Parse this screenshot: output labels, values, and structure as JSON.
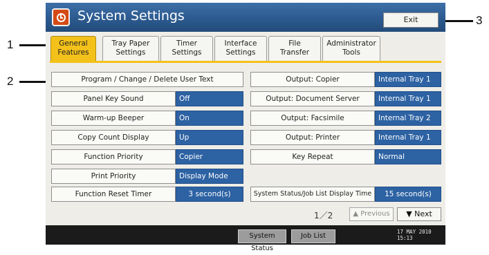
{
  "callouts": {
    "one": "1",
    "two": "2",
    "three": "3"
  },
  "header": {
    "title": "System Settings",
    "exit_label": "Exit"
  },
  "tabs": [
    {
      "line1": "General",
      "line2": "Features"
    },
    {
      "line1": "Tray Paper",
      "line2": "Settings"
    },
    {
      "line1": "Timer",
      "line2": "Settings"
    },
    {
      "line1": "Interface",
      "line2": "Settings"
    },
    {
      "line1": "File",
      "line2": "Transfer"
    },
    {
      "line1": "Administrator",
      "line2": "Tools"
    }
  ],
  "left_settings": {
    "program_text": "Program / Change / Delete User Text",
    "panel_key_sound": {
      "label": "Panel Key Sound",
      "value": "Off"
    },
    "warm_up_beeper": {
      "label": "Warm-up Beeper",
      "value": "On"
    },
    "copy_count_display": {
      "label": "Copy Count Display",
      "value": "Up"
    },
    "function_priority": {
      "label": "Function Priority",
      "value": "Copier"
    },
    "print_priority": {
      "label": "Print Priority",
      "value": "Display Mode"
    },
    "function_reset_timer": {
      "label": "Function Reset Timer",
      "value": "3 second(s)"
    }
  },
  "right_settings": {
    "output_copier": {
      "label": "Output: Copier",
      "value": "Internal Tray 1"
    },
    "output_document_server": {
      "label": "Output: Document Server",
      "value": "Internal Tray 1"
    },
    "output_facsimile": {
      "label": "Output: Facsimile",
      "value": "Internal Tray 2"
    },
    "output_printer": {
      "label": "Output: Printer",
      "value": "Internal Tray 1"
    },
    "key_repeat": {
      "label": "Key Repeat",
      "value": "Normal"
    },
    "system_status_timer": {
      "label": "System Status/Job List Display Time",
      "value": "15 second(s)"
    }
  },
  "pagination": {
    "page": "1／2",
    "previous": "▲ Previous",
    "next": "▼ Next"
  },
  "status_bar": {
    "system_status": "System Status",
    "job_list": "Job List",
    "date": "17 MAY  2010",
    "time": "15:13"
  },
  "colors": {
    "active_tab": "#f3c11a",
    "value_fill": "#2d62a3",
    "titlebar": "#2c5a8f"
  }
}
